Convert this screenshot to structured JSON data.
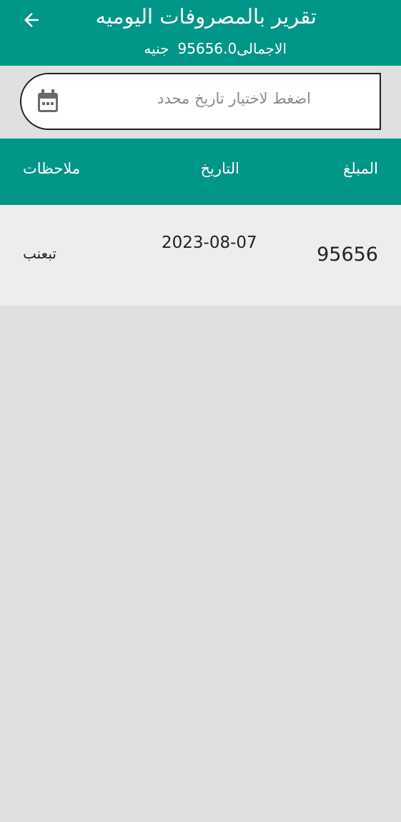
{
  "header": {
    "title": "تقرير بالمصروفات اليوميه",
    "total_label": "الاجمالى",
    "total_value": "95656.0",
    "currency": "جنيه",
    "back_icon": "arrow-left-icon",
    "color": "#009688"
  },
  "date_filter": {
    "placeholder": "اضغط لاختيار تاريخ محدد",
    "icon": "calendar-icon"
  },
  "table": {
    "columns": [
      "المبلغ",
      "التاريخ",
      "ملاحظات"
    ],
    "rows": [
      {
        "amount": "95656",
        "date": "2023-08-07",
        "notes": "تبعنب"
      }
    ]
  }
}
